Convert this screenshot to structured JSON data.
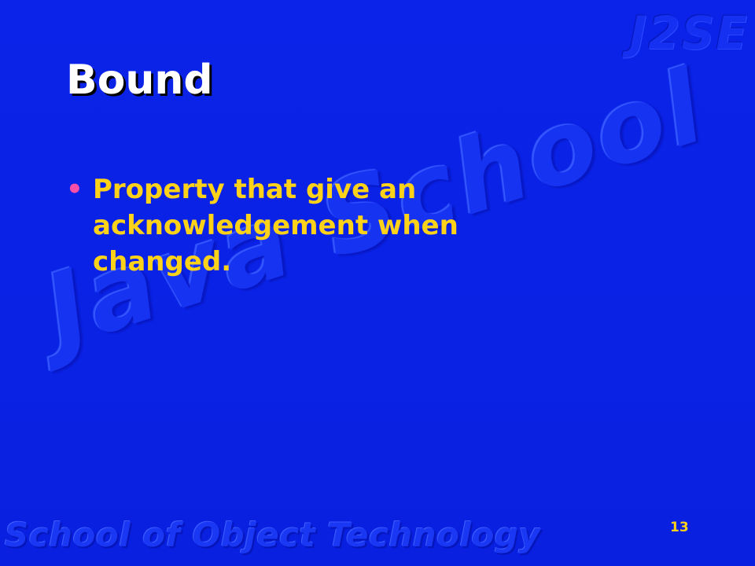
{
  "slide": {
    "corner_logo": "J2SE",
    "watermark": "Java School",
    "footer": "School of Object Technology",
    "title": "Bound",
    "bullets": [
      "Property that give an acknowledgement when changed."
    ],
    "page_number": "13",
    "colors": {
      "background": "#0a22e4",
      "title": "#ffffff",
      "bullet_text": "#ffd21a",
      "bullet_marker": "#ff4fa8"
    }
  }
}
